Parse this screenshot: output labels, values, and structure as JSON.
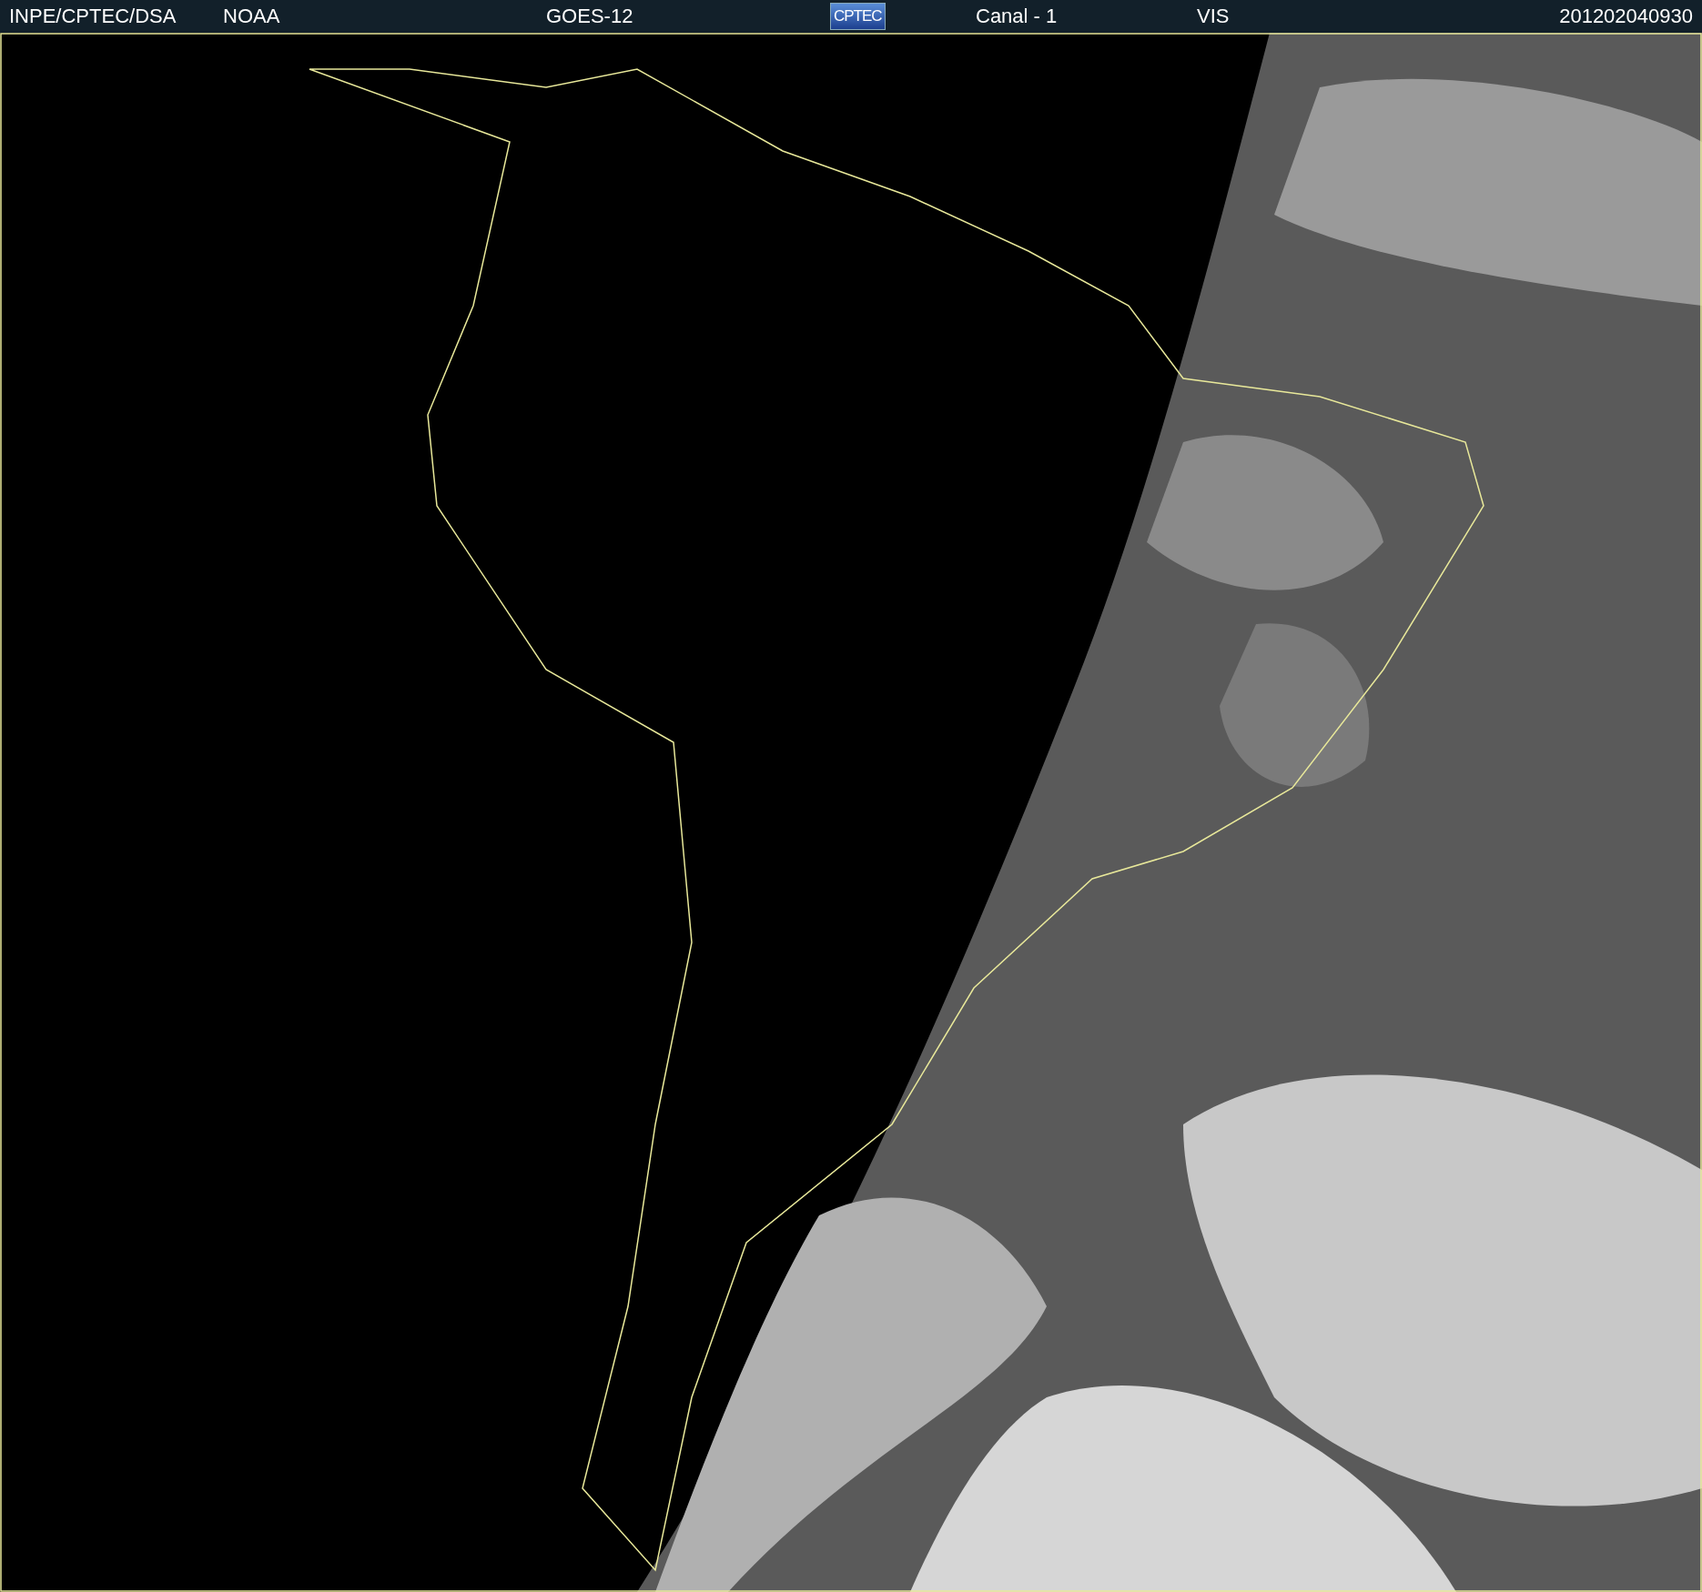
{
  "header": {
    "items": [
      {
        "kind": "text",
        "text": "INPE/CPTEC/DSA"
      },
      {
        "kind": "text",
        "text": "NOAA"
      },
      {
        "kind": "text",
        "text": "GOES-12"
      },
      {
        "kind": "logo",
        "text": "CPTEC"
      },
      {
        "kind": "text",
        "text": "Canal - 1"
      },
      {
        "kind": "text",
        "text": "VIS"
      },
      {
        "kind": "text",
        "text": "201202040930"
      }
    ]
  }
}
